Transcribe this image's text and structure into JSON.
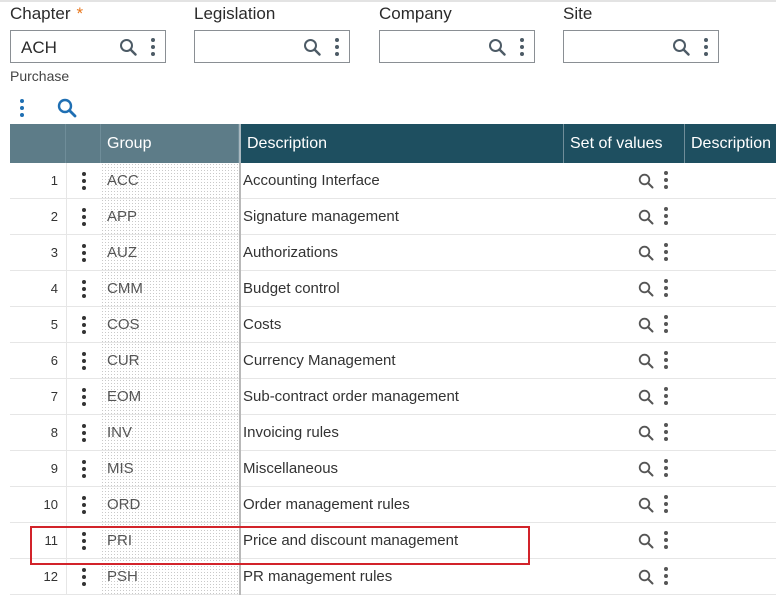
{
  "fields": {
    "chapter": {
      "label": "Chapter",
      "required_mark": "*",
      "value": "ACH",
      "description": "Purchase"
    },
    "legislation": {
      "label": "Legislation",
      "value": ""
    },
    "company": {
      "label": "Company",
      "value": ""
    },
    "site": {
      "label": "Site",
      "value": ""
    }
  },
  "colors": {
    "header_bg": "#1e4f60",
    "header_fixed_bg": "#5d7c88",
    "required": "#e8761c",
    "highlight": "#d2232a",
    "toolbar_icon": "#1f6fb3"
  },
  "toolbar": {
    "icons": [
      "more-vertical-icon",
      "search-icon"
    ]
  },
  "grid": {
    "columns": [
      "Group",
      "Description",
      "Set of values",
      "Description"
    ],
    "rows": [
      {
        "num": "1",
        "group": "ACC",
        "description": "Accounting Interface"
      },
      {
        "num": "2",
        "group": "APP",
        "description": "Signature management"
      },
      {
        "num": "3",
        "group": "AUZ",
        "description": "Authorizations"
      },
      {
        "num": "4",
        "group": "CMM",
        "description": "Budget control"
      },
      {
        "num": "5",
        "group": "COS",
        "description": "Costs"
      },
      {
        "num": "6",
        "group": "CUR",
        "description": "Currency Management"
      },
      {
        "num": "7",
        "group": "EOM",
        "description": "Sub-contract order management"
      },
      {
        "num": "8",
        "group": "INV",
        "description": "Invoicing rules"
      },
      {
        "num": "9",
        "group": "MIS",
        "description": "Miscellaneous"
      },
      {
        "num": "10",
        "group": "ORD",
        "description": "Order management rules"
      },
      {
        "num": "11",
        "group": "PRI",
        "description": "Price and discount management",
        "highlighted": true
      },
      {
        "num": "12",
        "group": "PSH",
        "description": "PR management rules"
      }
    ]
  }
}
